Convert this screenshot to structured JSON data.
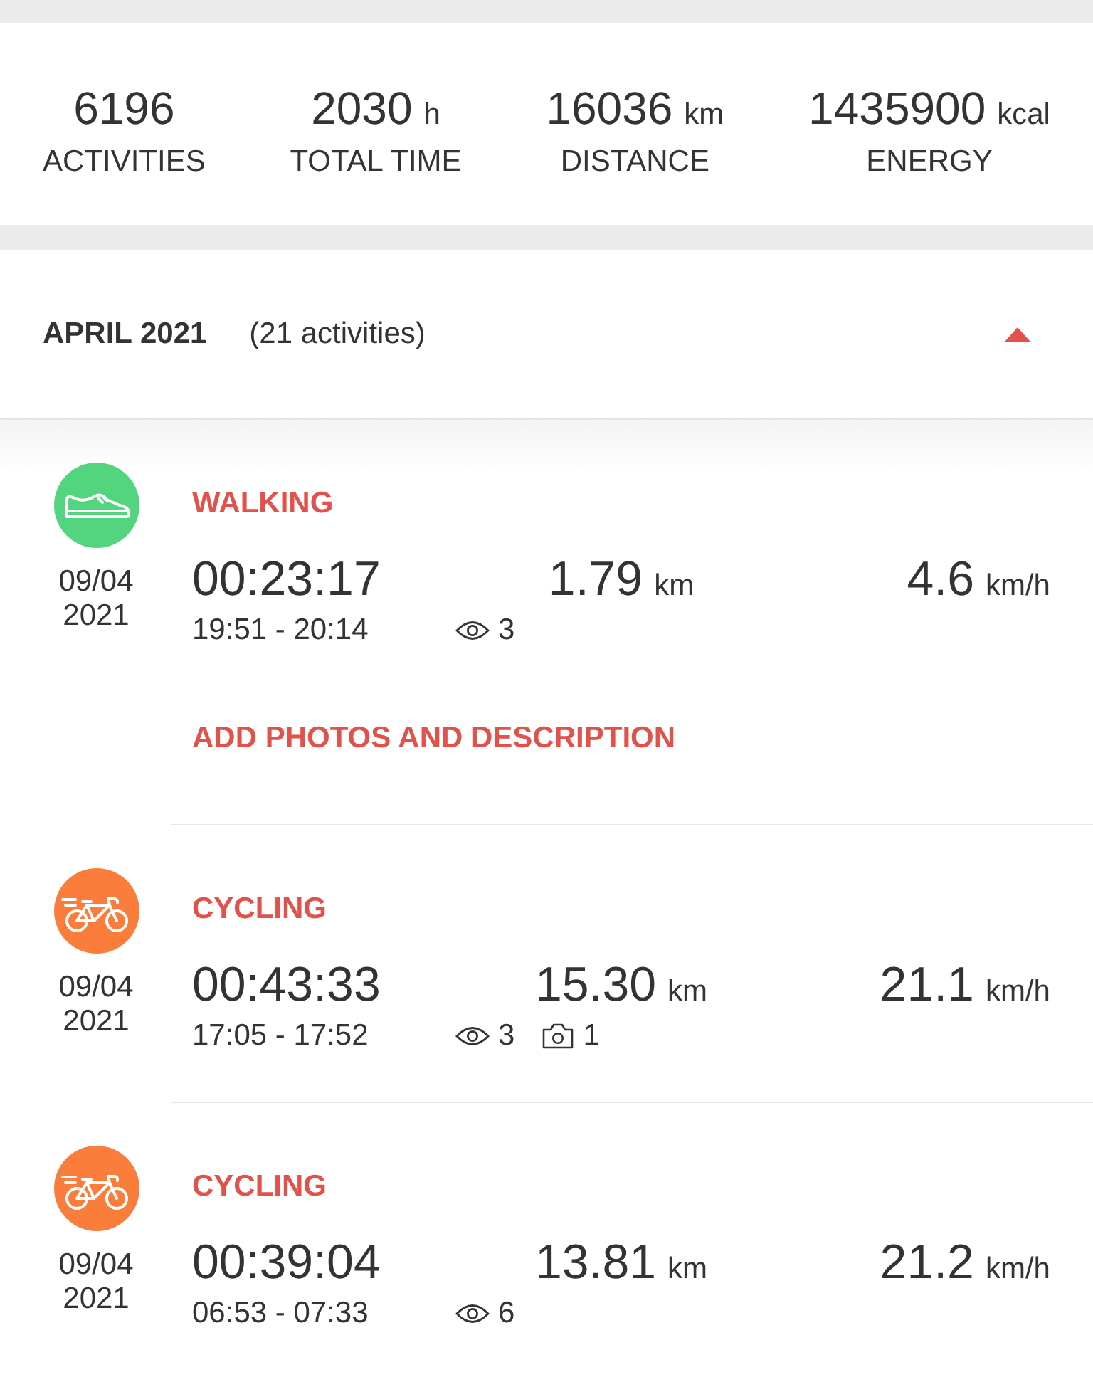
{
  "stats": [
    {
      "value": "6196",
      "label": "ACTIVITIES"
    },
    {
      "value": "2030",
      "unit": "h",
      "label": "TOTAL TIME"
    },
    {
      "value": "16036",
      "unit": "km",
      "label": "DISTANCE"
    },
    {
      "value": "1435900",
      "unit": "kcal",
      "label": "ENERGY"
    }
  ],
  "month": {
    "title": "APRIL 2021",
    "count": "(21 activities)",
    "expanded": true
  },
  "activities": [
    {
      "kind": "walking",
      "color": "#52d57e",
      "title": "WALKING",
      "date": "09/04",
      "year": "2021",
      "duration": "00:23:17",
      "distance": "1.79",
      "distance_unit": "km",
      "speed": "4.6",
      "speed_unit": "km/h",
      "time_range": "19:51 - 20:14",
      "views": "3",
      "action": "ADD PHOTOS AND DESCRIPTION"
    },
    {
      "kind": "cycling",
      "color": "#fb7d3c",
      "title": "CYCLING",
      "date": "09/04",
      "year": "2021",
      "duration": "00:43:33",
      "distance": "15.30",
      "distance_unit": "km",
      "speed": "21.1",
      "speed_unit": "km/h",
      "time_range": "17:05 - 17:52",
      "views": "3",
      "photos": "1"
    },
    {
      "kind": "cycling",
      "color": "#fb7d3c",
      "title": "CYCLING",
      "date": "09/04",
      "year": "2021",
      "duration": "00:39:04",
      "distance": "13.81",
      "distance_unit": "km",
      "speed": "21.2",
      "speed_unit": "km/h",
      "time_range": "06:53 - 07:33",
      "views": "6"
    }
  ]
}
